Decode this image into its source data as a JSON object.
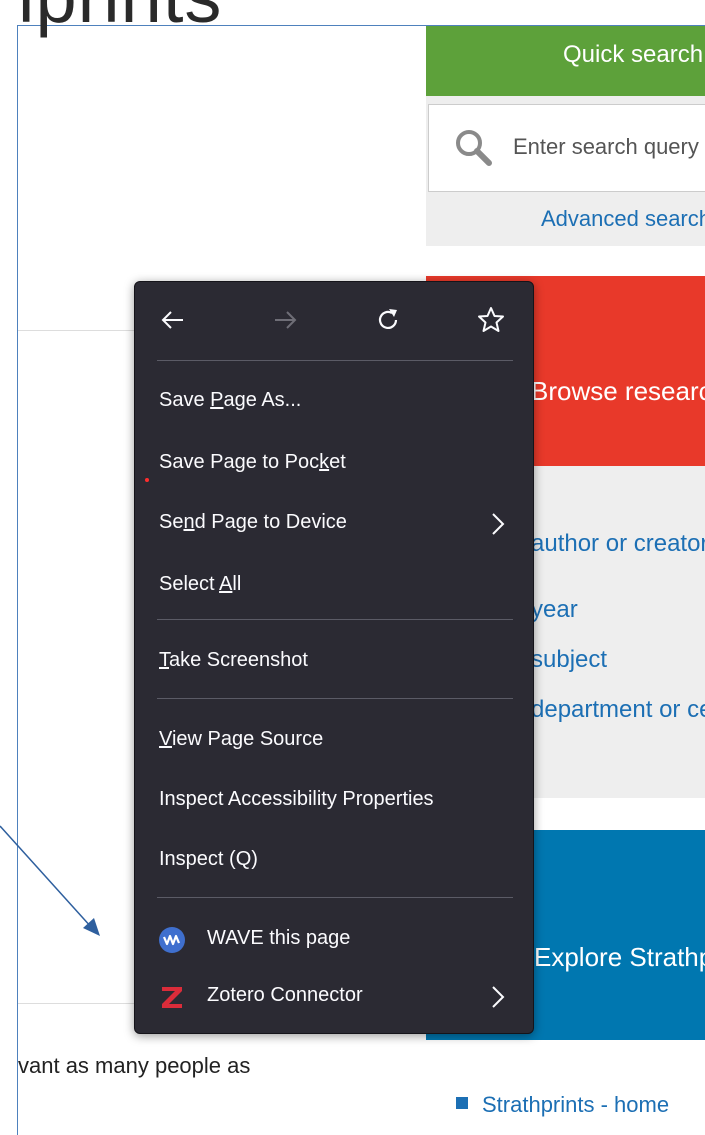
{
  "page": {
    "heading_fragment": "iprints",
    "body_text": "vant as many people as"
  },
  "sidebar": {
    "quick_search_title": "Quick search",
    "search_placeholder": "Enter search query",
    "advanced_search": "Advanced search",
    "browse_title": "Browse research",
    "browse_links": [
      "author or creator",
      "year",
      "subject",
      "department or centre"
    ],
    "explore_title": "Explore Strathprints",
    "list_items": [
      "Strathprints - home"
    ],
    "colors": {
      "green": "#5da13a",
      "red": "#e8392a",
      "blue": "#0077b0",
      "link": "#1c6fb4"
    }
  },
  "context_menu": {
    "nav": {
      "back_icon": "arrow-left-icon",
      "forward_icon": "arrow-right-icon",
      "reload_icon": "reload-icon",
      "bookmark_icon": "star-icon"
    },
    "items": [
      {
        "pre": "Save ",
        "key": "P",
        "post": "age As..."
      },
      {
        "pre": "Save Page to Poc",
        "key": "k",
        "post": "et"
      },
      {
        "pre": "Se",
        "key": "n",
        "post": "d Page to Device"
      },
      {
        "pre": "Select ",
        "key": "A",
        "post": "ll"
      },
      {
        "pre": "",
        "key": "T",
        "post": "ake Screenshot"
      },
      {
        "pre": "",
        "key": "V",
        "post": "iew Page Source"
      },
      {
        "pre": "Inspect Accessibility Properties",
        "key": "",
        "post": ""
      },
      {
        "pre": "Inspect (Q)",
        "key": "",
        "post": ""
      },
      {
        "pre": "WAVE this page",
        "key": "",
        "post": ""
      },
      {
        "pre": "Zotero Connector",
        "key": "",
        "post": ""
      }
    ],
    "colors": {
      "background": "#2b2a33",
      "text": "#fbfbfe",
      "separator": "#5b5b66",
      "wave_icon": "#3f6fce",
      "zotero_icon": "#db2c3a"
    }
  }
}
